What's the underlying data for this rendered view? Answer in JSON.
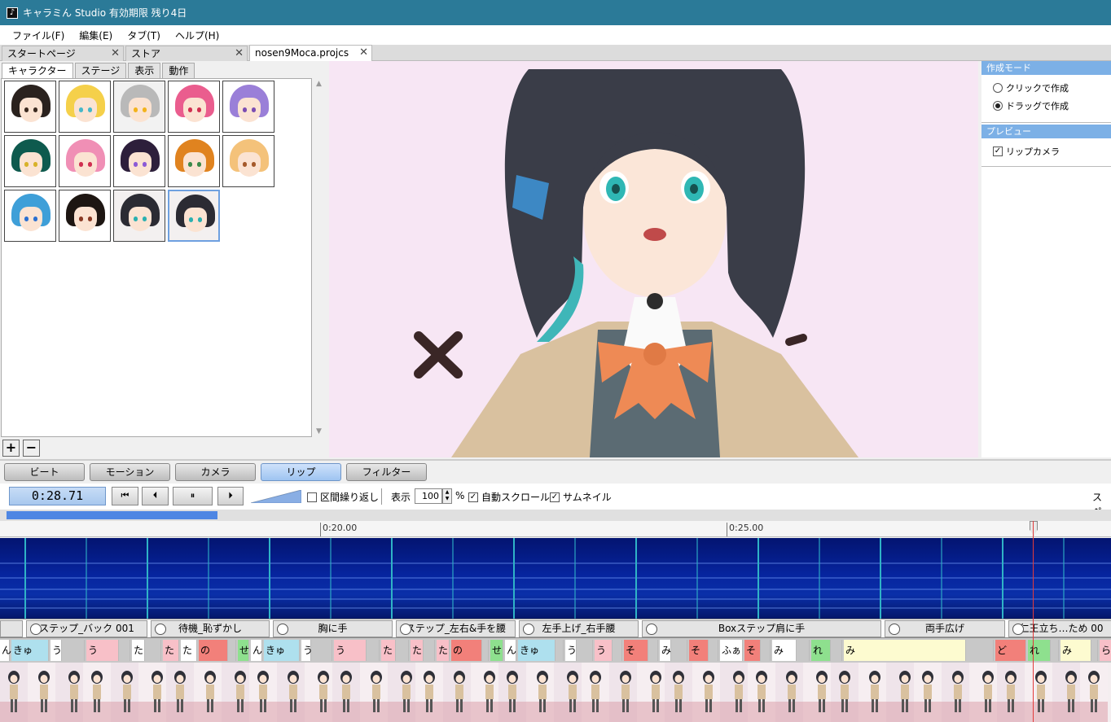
{
  "window": {
    "title": "キャラミん Studio  有効期限 残り4日",
    "app_icon": "music-note-icon"
  },
  "menu": [
    "ファイル(F)",
    "編集(E)",
    "タブ(T)",
    "ヘルプ(H)"
  ],
  "doc_tabs": [
    {
      "label": "スタートページ",
      "close": "✕"
    },
    {
      "label": "ストア",
      "close": "✕"
    },
    {
      "label": "nosen9Moca.projcs",
      "close": "✕"
    }
  ],
  "left_tabs": [
    "キャラクター",
    "ステージ",
    "表示",
    "動作"
  ],
  "characters": [
    {
      "hair": "#2a221e",
      "eye": "#3b2a20"
    },
    {
      "hair": "#f5d04a",
      "eye": "#46b7c9"
    },
    {
      "hair": "#b9b9b9",
      "eye": "#f3b31c"
    },
    {
      "hair": "#ea5d8e",
      "eye": "#d03050"
    },
    {
      "hair": "#9a7fd8",
      "eye": "#7b4db2"
    },
    {
      "hair": "#0e5a4e",
      "eye": "#d8b22a"
    },
    {
      "hair": "#f08fb5",
      "eye": "#d03050"
    },
    {
      "hair": "#2d1f3b",
      "eye": "#8c5ad6"
    },
    {
      "hair": "#e0831f",
      "eye": "#3b8a4a"
    },
    {
      "hair": "#f4c27a",
      "eye": "#a55a2b"
    },
    {
      "hair": "#3e9fd8",
      "eye": "#2b6fd0"
    },
    {
      "hair": "#1d1612",
      "eye": "#8a3a24"
    },
    {
      "hair": "#2b2b33",
      "eye": "#2bb0b0"
    },
    {
      "hair": "#2b2b33",
      "eye": "#2bb0b0"
    }
  ],
  "grid_buttons": {
    "add": "+",
    "remove": "−"
  },
  "right_panel": {
    "mode_header": "作成モード",
    "mode_options": [
      "クリックで作成",
      "ドラッグで作成"
    ],
    "mode_selected": 1,
    "preview_header": "プレビュー",
    "lip_camera_label": "リップカメラ",
    "lip_camera_checked": true
  },
  "editor_tabs": [
    "ビート",
    "モーション",
    "カメラ",
    "リップ",
    "フィルター"
  ],
  "editor_tab_active": 3,
  "toolbar": {
    "time": "0:28.71",
    "rewind_icon": "skip-to-start-icon",
    "prev_icon": "step-back-icon",
    "pause_icon": "pause-icon",
    "next_icon": "step-forward-icon",
    "loop_label": "区間繰り返し",
    "loop_checked": false,
    "display_label": "表示",
    "zoom_value": "100",
    "percent": "%",
    "autoscroll_label": "自動スクロール",
    "autoscroll_checked": true,
    "thumbnail_label": "サムネイル",
    "thumbnail_checked": true,
    "cutoff_label": "スペ"
  },
  "progress_fraction": 0.19,
  "ruler": [
    "0:20.00",
    "0:25.00"
  ],
  "motions": [
    "",
    "ステップ_バック 001",
    "待機_恥ずかし",
    "胸に手",
    "ステップ_左右&手を腰",
    "左手上げ_右手腰",
    "Boxステップ肩に手",
    "両手広げ",
    "仁王立ち…ため 00"
  ],
  "lips": [
    {
      "t": "ん",
      "c": "#ffffff"
    },
    {
      "t": "きゅ",
      "c": "#aee0ee"
    },
    {
      "t": "う",
      "c": "#ffffff"
    },
    {
      "t": "",
      "c": "#c8c8c8"
    },
    {
      "t": "う",
      "c": "#f8c0c8"
    },
    {
      "t": "",
      "c": "#c8c8c8"
    },
    {
      "t": "た",
      "c": "#ffffff"
    },
    {
      "t": "",
      "c": "#c8c8c8"
    },
    {
      "t": "た",
      "c": "#f8c0c8"
    },
    {
      "t": "た",
      "c": "#ffffff"
    },
    {
      "t": "の",
      "c": "#f2807a"
    },
    {
      "t": "",
      "c": "#c8c8c8"
    },
    {
      "t": "せ",
      "c": "#8ee08e"
    },
    {
      "t": "ん",
      "c": "#ffffff"
    },
    {
      "t": "きゅ",
      "c": "#aee0ee"
    },
    {
      "t": "う",
      "c": "#ffffff"
    },
    {
      "t": "",
      "c": "#c8c8c8"
    },
    {
      "t": "う",
      "c": "#f8c0c8"
    },
    {
      "t": "",
      "c": "#c8c8c8"
    },
    {
      "t": "た",
      "c": "#f8c0c8"
    },
    {
      "t": "",
      "c": "#c8c8c8"
    },
    {
      "t": "た",
      "c": "#f8c0c8"
    },
    {
      "t": "",
      "c": "#c8c8c8"
    },
    {
      "t": "た",
      "c": "#f8c0c8"
    },
    {
      "t": "の",
      "c": "#f2807a"
    },
    {
      "t": "",
      "c": "#c8c8c8"
    },
    {
      "t": "せ",
      "c": "#8ee08e"
    },
    {
      "t": "ん",
      "c": "#ffffff"
    },
    {
      "t": "きゅ",
      "c": "#aee0ee"
    },
    {
      "t": "",
      "c": "#c8c8c8"
    },
    {
      "t": "う",
      "c": "#ffffff"
    },
    {
      "t": "",
      "c": "#c8c8c8"
    },
    {
      "t": "う",
      "c": "#f8c0c8"
    },
    {
      "t": "",
      "c": "#c8c8c8"
    },
    {
      "t": "そ",
      "c": "#f2807a"
    },
    {
      "t": "",
      "c": "#c8c8c8"
    },
    {
      "t": "み",
      "c": "#ffffff"
    },
    {
      "t": "",
      "c": "#c8c8c8"
    },
    {
      "t": "そ",
      "c": "#f2807a"
    },
    {
      "t": "",
      "c": "#c8c8c8"
    },
    {
      "t": "ふぁ",
      "c": "#ffffff"
    },
    {
      "t": "そ",
      "c": "#f2807a"
    },
    {
      "t": "",
      "c": "#c8c8c8"
    },
    {
      "t": "み",
      "c": "#ffffff"
    },
    {
      "t": "",
      "c": "#c8c8c8"
    },
    {
      "t": "れ",
      "c": "#8ee08e"
    },
    {
      "t": "",
      "c": "#c8c8c8"
    },
    {
      "t": "み",
      "c": "#fdfbd0"
    },
    {
      "t": "",
      "c": "#c8c8c8"
    },
    {
      "t": "ど",
      "c": "#f2807a"
    },
    {
      "t": "れ",
      "c": "#8ee08e"
    },
    {
      "t": "",
      "c": "#c8c8c8"
    },
    {
      "t": "み",
      "c": "#fdfbd0"
    },
    {
      "t": "",
      "c": "#c8c8c8"
    },
    {
      "t": "ら",
      "c": "#f8c0c8"
    },
    {
      "t": "",
      "c": "#c8c8c8"
    }
  ],
  "colors": {
    "titlebar": "#2b7a98",
    "accent_blue": "#4e86e3",
    "beat_line": "#2fb3c6",
    "playhead": "#e23b3b"
  }
}
